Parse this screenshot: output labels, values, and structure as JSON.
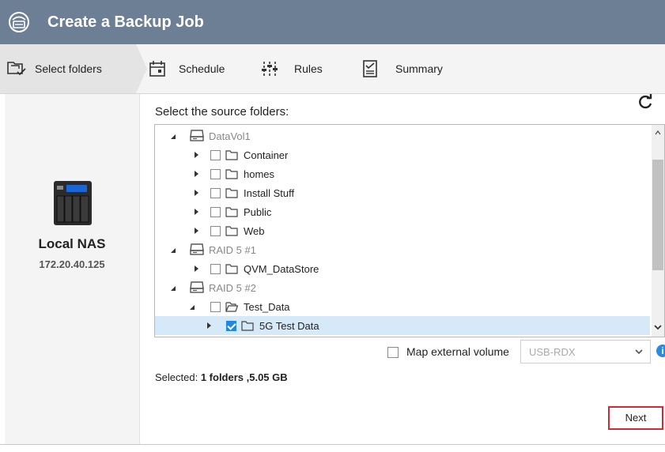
{
  "title": "Create a Backup Job",
  "steps": [
    {
      "label": "Select folders",
      "icon": "folder-check-icon",
      "active": true
    },
    {
      "label": "Schedule",
      "icon": "calendar-icon",
      "active": false
    },
    {
      "label": "Rules",
      "icon": "sliders-icon",
      "active": false
    },
    {
      "label": "Summary",
      "icon": "checklist-icon",
      "active": false
    }
  ],
  "device": {
    "name": "Local NAS",
    "ip": "172.20.40.125",
    "icon": "nas-device-icon"
  },
  "source": {
    "prompt": "Select the source folders:"
  },
  "tree": [
    {
      "label": "DataVol1",
      "type": "volume",
      "level": 0,
      "expanded": true,
      "checked": false
    },
    {
      "label": "Container",
      "type": "folder",
      "level": 1,
      "expanded": false,
      "checked": false
    },
    {
      "label": "homes",
      "type": "folder",
      "level": 1,
      "expanded": false,
      "checked": false
    },
    {
      "label": "Install Stuff",
      "type": "folder",
      "level": 1,
      "expanded": false,
      "checked": false
    },
    {
      "label": "Public",
      "type": "folder",
      "level": 1,
      "expanded": false,
      "checked": false
    },
    {
      "label": "Web",
      "type": "folder",
      "level": 1,
      "expanded": false,
      "checked": false
    },
    {
      "label": "RAID 5 #1",
      "type": "volume",
      "level": 0,
      "expanded": true,
      "checked": false
    },
    {
      "label": "QVM_DataStore",
      "type": "folder",
      "level": 1,
      "expanded": false,
      "checked": false
    },
    {
      "label": "RAID 5 #2",
      "type": "volume",
      "level": 0,
      "expanded": true,
      "checked": false
    },
    {
      "label": "Test_Data",
      "type": "folder-open",
      "level": 1,
      "expanded": true,
      "checked": false
    },
    {
      "label": "5G Test Data",
      "type": "folder",
      "level": 2,
      "expanded": false,
      "checked": true
    }
  ],
  "map_external": {
    "label": "Map external volume",
    "checked": false,
    "select_value": "USB-RDX"
  },
  "selection": {
    "prefix": "Selected:",
    "summary": "1 folders ,5.05 GB"
  },
  "buttons": {
    "next": "Next"
  },
  "colors": {
    "titlebar": "#6c7f95",
    "selected_row": "#d6e9f8",
    "checkbox_checked": "#1e88e5",
    "next_highlight": "#d7282f",
    "info": "#2a8ae0"
  }
}
